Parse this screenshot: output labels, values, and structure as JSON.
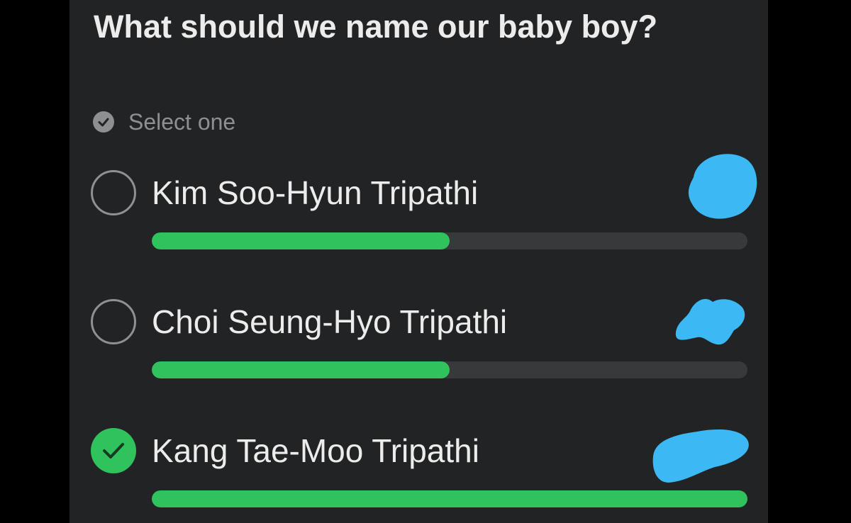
{
  "poll": {
    "question": "What should we name our baby boy?",
    "mode_hint": "Select one",
    "hint_icon": "check-circle-icon",
    "colors": {
      "panel": "#222324",
      "text": "#ececec",
      "muted": "#8e8f91",
      "accent": "#2fc25d",
      "track": "#38393b",
      "redaction": "#3cb8f5"
    },
    "options": [
      {
        "label": "Kim Soo-Hyun Tripathi",
        "selected": false,
        "vote_fraction": 0.5
      },
      {
        "label": "Choi Seung-Hyo Tripathi",
        "selected": false,
        "vote_fraction": 0.5
      },
      {
        "label": "Kang Tae-Moo Tripathi",
        "selected": true,
        "vote_fraction": 1.0
      }
    ]
  }
}
